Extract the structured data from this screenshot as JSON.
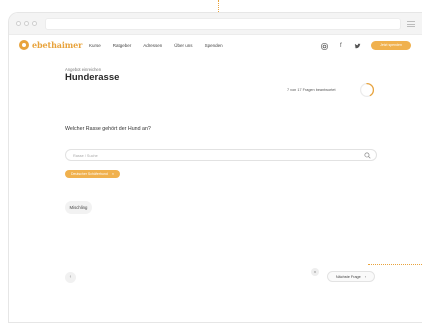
{
  "brand": {
    "name": "ebethaimer",
    "accent": "#e8a33c",
    "cta_bg": "#f0b14e"
  },
  "nav": {
    "links": [
      "Kurse",
      "Ratgeber",
      "Adressen",
      "Über uns",
      "Spenden"
    ],
    "icons": [
      "instagram-icon",
      "facebook-icon",
      "twitter-icon"
    ],
    "cta_label": "Jetzt spenden"
  },
  "quiz": {
    "eyebrow": "Angebot einreichen",
    "title": "Hunderasse",
    "progress_text": "7 von 17 Fragen beantwortet",
    "progress": {
      "answered": 7,
      "total": 17
    },
    "question": "Welcher Rasse gehört der Hund an?",
    "search": {
      "placeholder": "Rasse / Suche",
      "value": ""
    },
    "selected_chip": "Deutscher Schäferhund",
    "option": "Mischling",
    "back_label": "‹",
    "skip_label": "x",
    "next_label": "Nächste Frage",
    "next_arrow": "›"
  }
}
